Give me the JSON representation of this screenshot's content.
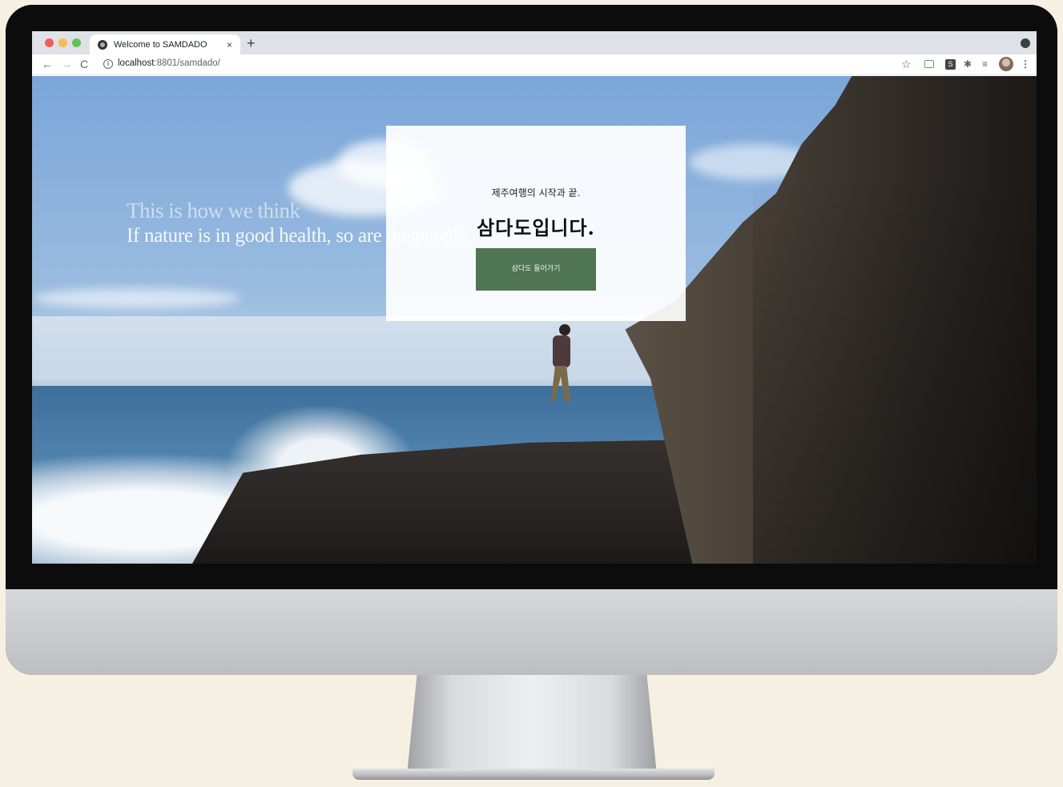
{
  "browser": {
    "tab_title": "Welcome to SAMDADO",
    "tab_close": "×",
    "new_tab": "+",
    "url_host": "localhost",
    "url_path": ":8801/samdado/"
  },
  "toolbar_icons": {
    "back": "←",
    "forward": "→",
    "reload": "C",
    "info": "i",
    "star": "☆",
    "ext_s": "S",
    "puzzle": "✱",
    "list": "≡",
    "menu": "⋮"
  },
  "page": {
    "tagline_line1": "This is how we think",
    "tagline_line2": "If nature is in good health, so are the people",
    "hero_sub": "제주여행의 시작과 끝.",
    "hero_title": "삼다도입니다.",
    "cta_label": "삼다도 들어가기",
    "cta_color": "#4f7552"
  },
  "colors": {
    "background": "#f6f0e3",
    "tabstrip": "#dee1e6"
  }
}
